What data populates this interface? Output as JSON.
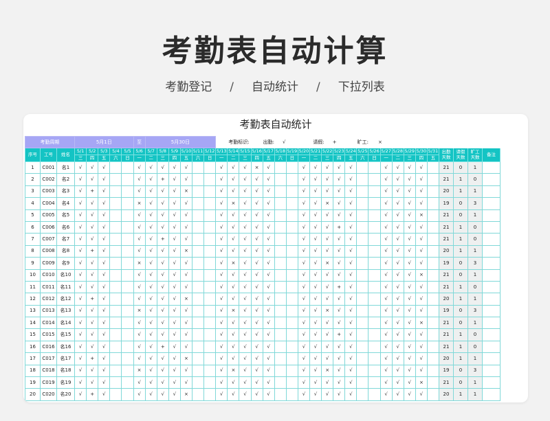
{
  "page": {
    "title": "考勤表自动计算",
    "subtitle": [
      "考勤登记",
      "自动统计",
      "下拉列表"
    ],
    "separator": "/"
  },
  "sheet": {
    "title": "考勤表自动统计",
    "period_label": "考勤周期",
    "start_date": "5月1日",
    "to_label": "至",
    "end_date": "5月30日",
    "legend": {
      "label": "考勤标识:",
      "present_label": "出勤:",
      "present_mark": "√",
      "leave_label": "请假:",
      "leave_mark": "+",
      "absent_label": "旷工:",
      "absent_mark": "×"
    },
    "headers": {
      "no": "序号",
      "id": "工号",
      "name": "姓名",
      "present_days": [
        "出勤",
        "天数"
      ],
      "leave_days": [
        "请假",
        "天数"
      ],
      "absent_days": [
        "旷工",
        "天数"
      ],
      "remark": "备注"
    },
    "dates": [
      "5/1",
      "5/2",
      "5/3",
      "5/4",
      "5/5",
      "5/6",
      "5/7",
      "5/8",
      "5/9",
      "5/10",
      "5/11",
      "5/12",
      "5/13",
      "5/14",
      "5/15",
      "5/16",
      "5/17",
      "5/18",
      "5/19",
      "5/20",
      "5/21",
      "5/22",
      "5/23",
      "5/24",
      "5/25",
      "5/26",
      "5/27",
      "5/28",
      "5/29",
      "5/30",
      "5/31"
    ],
    "weekdays": [
      "三",
      "四",
      "五",
      "六",
      "日",
      "一",
      "二",
      "三",
      "四",
      "五",
      "六",
      "日",
      "一",
      "二",
      "三",
      "四",
      "五",
      "六",
      "日",
      "一",
      "二",
      "三",
      "四",
      "五",
      "六",
      "日",
      "一",
      "二",
      "三",
      "四",
      "五"
    ],
    "rows": [
      {
        "no": "1",
        "id": "C001",
        "name": "名1",
        "marks": "√√√  √√√√√  √√√×√  √√√√√  √√√√ ",
        "present": "21",
        "leave": "0",
        "absent": "1"
      },
      {
        "no": "2",
        "id": "C002",
        "name": "名2",
        "marks": "√√√  √√+√√  √√√√√  √√√√√  √√√√ ",
        "present": "21",
        "leave": "1",
        "absent": "0"
      },
      {
        "no": "3",
        "id": "C003",
        "name": "名3",
        "marks": "√+√  √√√√×  √√√√√  √√√√√  √√√√ ",
        "present": "20",
        "leave": "1",
        "absent": "1"
      },
      {
        "no": "4",
        "id": "C004",
        "name": "名4",
        "marks": "√√√  ×√√√√  √×√√√  √√×√√  √√√√ ",
        "present": "19",
        "leave": "0",
        "absent": "3"
      },
      {
        "no": "5",
        "id": "C005",
        "name": "名5",
        "marks": "√√√  √√√√√  √√√√√  √√√√√  √√√× ",
        "present": "21",
        "leave": "0",
        "absent": "1"
      },
      {
        "no": "6",
        "id": "C006",
        "name": "名6",
        "marks": "√√√  √√√√√  √√√√√  √√√+√  √√√√ ",
        "present": "21",
        "leave": "1",
        "absent": "0"
      },
      {
        "no": "7",
        "id": "C007",
        "name": "名7",
        "marks": "√√√  √√+√√  √√√√√  √√√√√  √√√√ ",
        "present": "21",
        "leave": "1",
        "absent": "0"
      },
      {
        "no": "8",
        "id": "C008",
        "name": "名8",
        "marks": "√+√  √√√√×  √√√√√  √√√√√  √√√√ ",
        "present": "20",
        "leave": "1",
        "absent": "1"
      },
      {
        "no": "9",
        "id": "C009",
        "name": "名9",
        "marks": "√√√  ×√√√√  √×√√√  √√×√√  √√√√ ",
        "present": "19",
        "leave": "0",
        "absent": "3"
      },
      {
        "no": "10",
        "id": "C010",
        "name": "名10",
        "marks": "√√√  √√√√√  √√√√√  √√√√√  √√√× ",
        "present": "21",
        "leave": "0",
        "absent": "1"
      },
      {
        "no": "11",
        "id": "C011",
        "name": "名11",
        "marks": "√√√  √√√√√  √√√√√  √√√+√  √√√√ ",
        "present": "21",
        "leave": "1",
        "absent": "0"
      },
      {
        "no": "12",
        "id": "C012",
        "name": "名12",
        "marks": "√+√  √√√√×  √√√√√  √√√√√  √√√√ ",
        "present": "20",
        "leave": "1",
        "absent": "1"
      },
      {
        "no": "13",
        "id": "C013",
        "name": "名13",
        "marks": "√√√  ×√√√√  √×√√√  √√×√√  √√√√ ",
        "present": "19",
        "leave": "0",
        "absent": "3"
      },
      {
        "no": "14",
        "id": "C014",
        "name": "名14",
        "marks": "√√√  √√√√√  √√√√√  √√√√√  √√√× ",
        "present": "21",
        "leave": "0",
        "absent": "1"
      },
      {
        "no": "15",
        "id": "C015",
        "name": "名15",
        "marks": "√√√  √√√√√  √√√√√  √√√+√  √√√√ ",
        "present": "21",
        "leave": "1",
        "absent": "0"
      },
      {
        "no": "16",
        "id": "C016",
        "name": "名16",
        "marks": "√√√  √√+√√  √√√√√  √√√√√  √√√√ ",
        "present": "21",
        "leave": "1",
        "absent": "0"
      },
      {
        "no": "17",
        "id": "C017",
        "name": "名17",
        "marks": "√+√  √√√√×  √√√√√  √√√√√  √√√√ ",
        "present": "20",
        "leave": "1",
        "absent": "1"
      },
      {
        "no": "18",
        "id": "C018",
        "name": "名18",
        "marks": "√√√  ×√√√√  √×√√√  √√×√√  √√√√ ",
        "present": "19",
        "leave": "0",
        "absent": "3"
      },
      {
        "no": "19",
        "id": "C019",
        "name": "名19",
        "marks": "√√√  √√√√√  √√√√√  √√√√√  √√√× ",
        "present": "21",
        "leave": "0",
        "absent": "1"
      },
      {
        "no": "20",
        "id": "C020",
        "name": "名20",
        "marks": "√+√  √√√√×  √√√√√  √√√√√  √√√√ ",
        "present": "20",
        "leave": "1",
        "absent": "1"
      }
    ]
  },
  "colors": {
    "teal": "#14c4c4",
    "purple": "#a6a6f5",
    "grid": "#7fd8d8"
  }
}
